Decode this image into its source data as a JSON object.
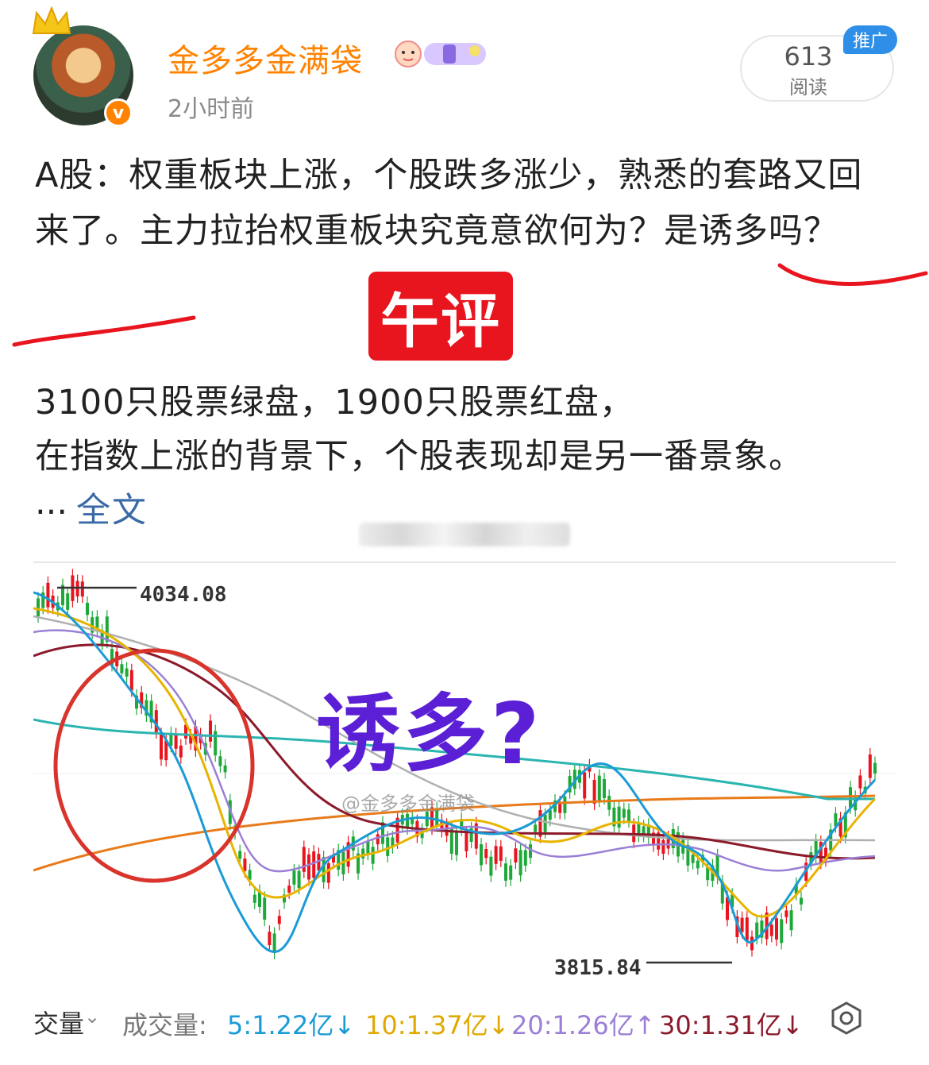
{
  "header": {
    "username": "金多多金满袋",
    "timestamp": "2小时前",
    "read_count": "613",
    "read_label": "阅读",
    "promo_tag": "推广",
    "verified_mark": "v"
  },
  "post": {
    "headline": "A股：权重板块上涨，个股跌多涨少，熟悉的套路又回来了。主力拉抬权重板块究竟意欲何为？是诱多吗？",
    "stamp": "午评",
    "line1": "3100只股票绿盘，1900只股票红盘，",
    "line2": "在指数上涨的背景下，个股表现却是另一番景象。",
    "ellipsis": "...",
    "full_text_link": "全文"
  },
  "chart": {
    "overlay_text": "诱多?",
    "watermark": "@金多多金满袋",
    "high_label": "4034.08",
    "low_label": "3815.84"
  },
  "volume_bar": {
    "tab_label": "交量",
    "title": "成交量:",
    "ma5": "5:1.22亿↓",
    "ma10": "10:1.37亿↓",
    "ma20": "20:1.26亿↑",
    "ma30": "30:1.31亿↓",
    "colors": {
      "ma5": "#1a9bd6",
      "ma10": "#e0a800",
      "ma20": "#9b7fd6",
      "ma30": "#8b1a2b"
    }
  },
  "chart_data": {
    "type": "candlestick",
    "annotations": [
      "4034.08",
      "3815.84"
    ],
    "ma_colors": {
      "ma5": "#1a9bd6",
      "ma10": "#e8b400",
      "ma20": "#9b7fd6",
      "ma30": "#8b1a2b",
      "ma60": "#b0b0b0",
      "ma120": "#2bb5b0",
      "ma250": "#e87a1a"
    },
    "up_color": "#e8141e",
    "down_color": "#1fa83a"
  }
}
